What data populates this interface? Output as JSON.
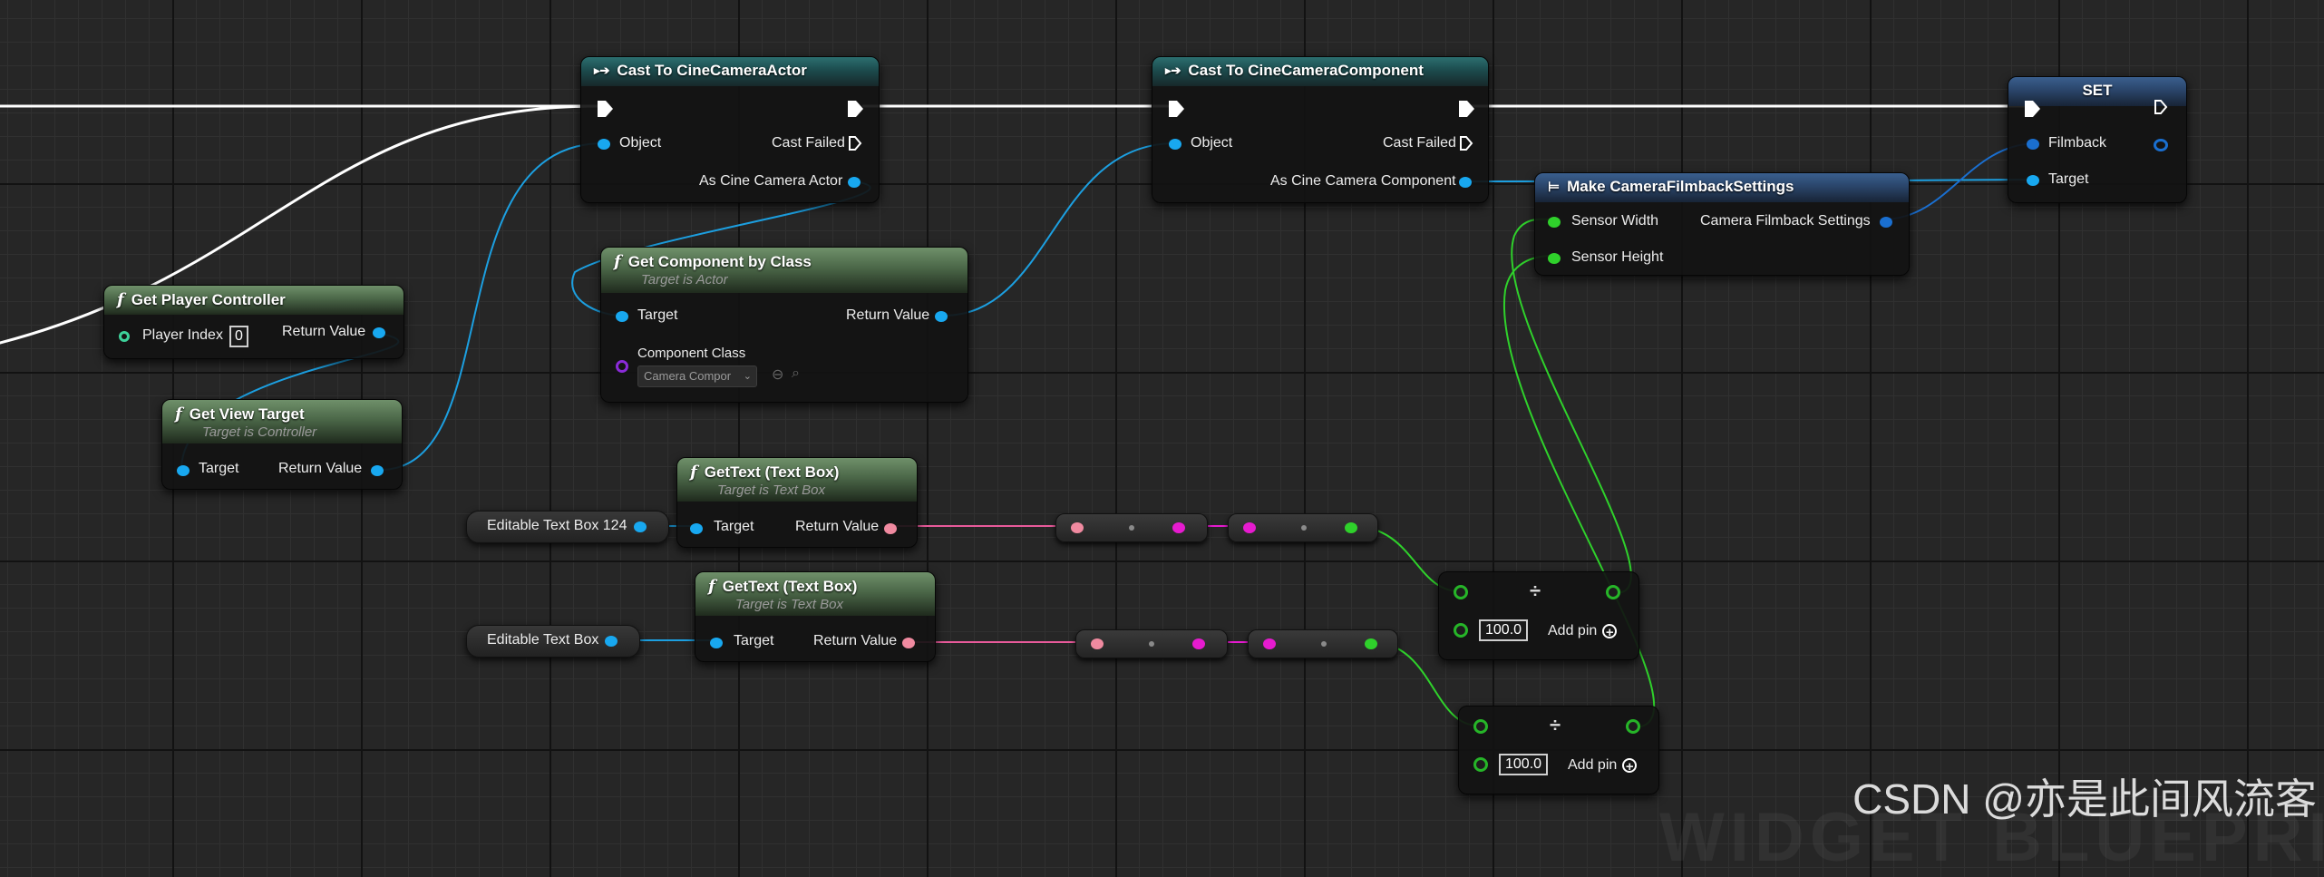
{
  "cast_actor": {
    "title": "Cast To CineCameraActor",
    "object": "Object",
    "cast_failed": "Cast Failed",
    "as_output": "As Cine Camera Actor"
  },
  "cast_component": {
    "title": "Cast To CineCameraComponent",
    "object": "Object",
    "cast_failed": "Cast Failed",
    "as_output": "As Cine Camera Component"
  },
  "set_node": {
    "title": "SET",
    "filmback": "Filmback",
    "target": "Target"
  },
  "make_filmback": {
    "title": "Make CameraFilmbackSettings",
    "sensor_width": "Sensor Width",
    "sensor_height": "Sensor Height",
    "output": "Camera Filmback Settings"
  },
  "get_component": {
    "title": "Get Component by Class",
    "subtitle": "Target is Actor",
    "target": "Target",
    "return_value": "Return Value",
    "component_class": "Component Class",
    "class_value": "Camera Compor"
  },
  "get_player_controller": {
    "title": "Get Player Controller",
    "player_index": "Player Index",
    "player_index_value": "0",
    "return_value": "Return Value"
  },
  "get_view_target": {
    "title": "Get View Target",
    "subtitle": "Target is Controller",
    "target": "Target",
    "return_value": "Return Value"
  },
  "get_text_1": {
    "title": "GetText (Text Box)",
    "subtitle": "Target is Text Box",
    "target": "Target",
    "return_value": "Return Value"
  },
  "get_text_2": {
    "title": "GetText (Text Box)",
    "subtitle": "Target is Text Box",
    "target": "Target",
    "return_value": "Return Value"
  },
  "var_1": {
    "label": "Editable Text Box 124"
  },
  "var_2": {
    "label": "Editable Text Box"
  },
  "divide_1": {
    "symbol": "÷",
    "value": "100.0",
    "add_pin": "Add pin"
  },
  "divide_2": {
    "symbol": "÷",
    "value": "100.0",
    "add_pin": "Add pin"
  },
  "watermark": "CSDN @亦是此间风流客",
  "background_text": "WIDGET BLUEPRI"
}
